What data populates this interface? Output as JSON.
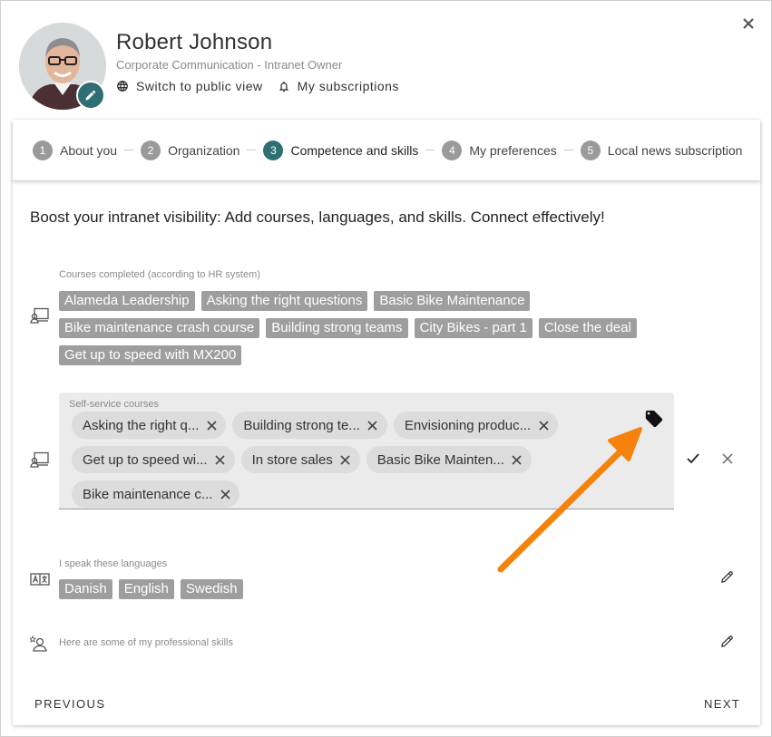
{
  "profile": {
    "name": "Robert Johnson",
    "role": "Corporate Communication - Intranet Owner",
    "links": {
      "public_view": "Switch to public view",
      "subscriptions": "My subscriptions"
    }
  },
  "stepper": {
    "steps": [
      {
        "num": "1",
        "label": "About you"
      },
      {
        "num": "2",
        "label": "Organization"
      },
      {
        "num": "3",
        "label": "Competence and skills"
      },
      {
        "num": "4",
        "label": "My preferences"
      },
      {
        "num": "5",
        "label": "Local news subscription"
      }
    ],
    "active_index": 2
  },
  "intro": "Boost your intranet visibility: Add courses, languages, and skills. Connect effectively!",
  "courses_completed": {
    "label": "Courses completed (according to HR system)",
    "tags": [
      "Alameda Leadership",
      "Asking the right questions",
      "Basic Bike Maintenance",
      "Bike maintenance crash course",
      "Building strong teams",
      "City Bikes - part 1",
      "Close the deal",
      "Get up to speed with MX200"
    ]
  },
  "self_service": {
    "label": "Self-service courses",
    "chips": [
      "Asking the right q...",
      "Building strong te...",
      "Envisioning produc...",
      "Get up to speed wi...",
      "In store sales",
      "Basic Bike Mainten...",
      "Bike maintenance c..."
    ]
  },
  "languages": {
    "label": "I speak these languages",
    "tags": [
      "Danish",
      "English",
      "Swedish"
    ]
  },
  "skills": {
    "label": "Here are some of my professional skills"
  },
  "footer": {
    "previous": "PREVIOUS",
    "next": "NEXT"
  },
  "colors": {
    "accent": "#2f6f73",
    "tag_bg": "#9e9e9e",
    "chip_bg": "#dcdcdc",
    "annotation_arrow": "#f5820d"
  }
}
